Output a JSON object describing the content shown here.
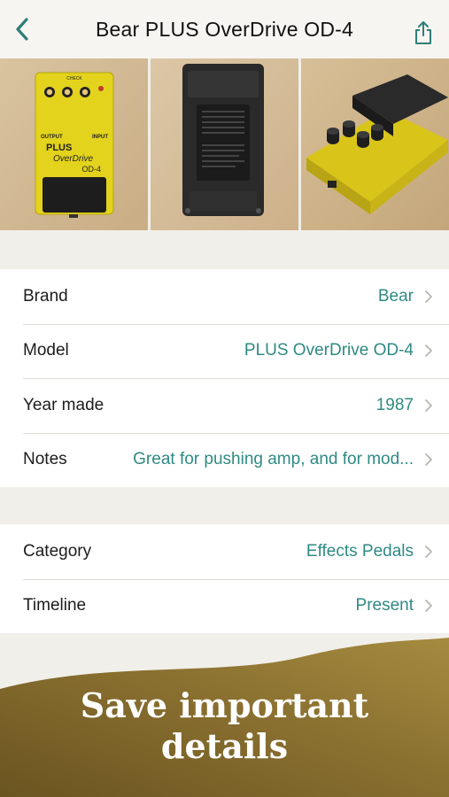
{
  "nav": {
    "title": "Bear PLUS OverDrive OD-4",
    "back_icon": "chevron-left-icon",
    "share_icon": "share-icon",
    "accent_color": "#2f7d78"
  },
  "photos": [
    {
      "name": "pedal-front-photo"
    },
    {
      "name": "pedal-back-photo"
    },
    {
      "name": "pedal-angle-photo"
    }
  ],
  "pedal_print": {
    "brand_line": "PLUS",
    "model_line": "OverDrive",
    "code": "OD-4",
    "output": "OUTPUT",
    "input": "INPUT",
    "check": "CHECK"
  },
  "details": {
    "brand": {
      "label": "Brand",
      "value": "Bear"
    },
    "model": {
      "label": "Model",
      "value": "PLUS OverDrive OD-4"
    },
    "year": {
      "label": "Year made",
      "value": "1987"
    },
    "notes": {
      "label": "Notes",
      "value": "Great for pushing amp, and for mod..."
    }
  },
  "classification": {
    "category": {
      "label": "Category",
      "value": "Effects Pedals"
    },
    "timeline": {
      "label": "Timeline",
      "value": "Present"
    }
  },
  "banner": {
    "line1": "Save important",
    "line2": "details",
    "gradient_start": "#6a5420",
    "gradient_end": "#a58b3f"
  }
}
